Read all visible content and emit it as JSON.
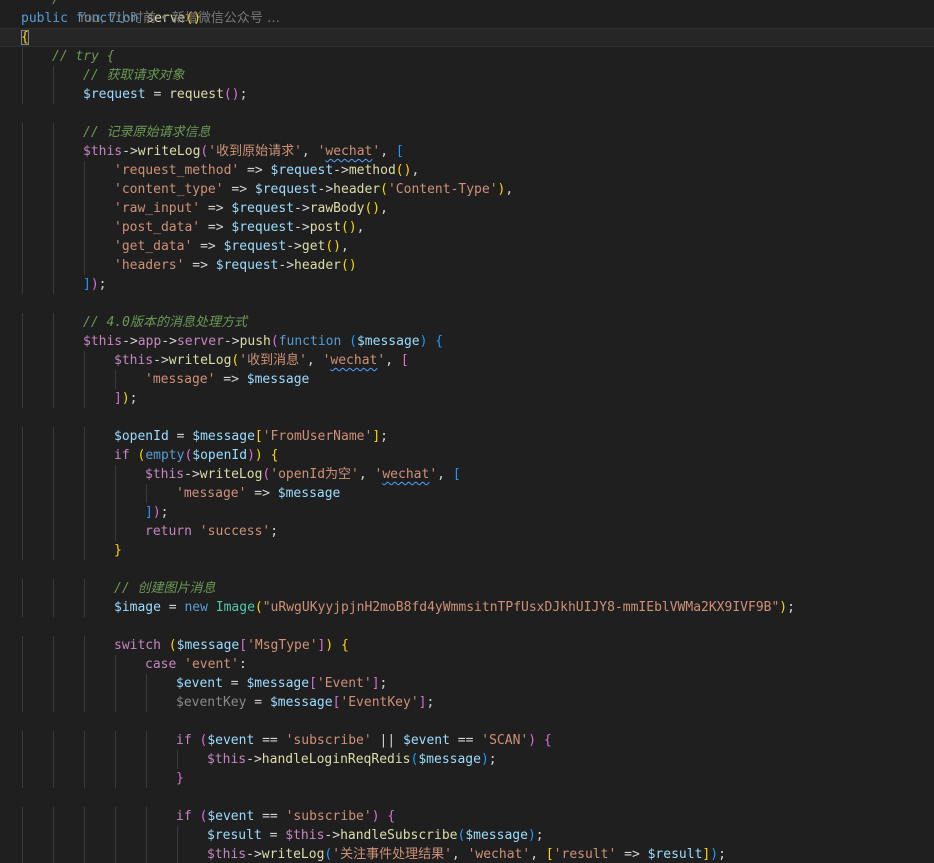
{
  "editor": {
    "blame": {
      "line": 1,
      "text": "You, 7小时前 • 新增微信公众号 …"
    },
    "lines": [
      {
        "indent": 0,
        "tokens": [
          [
            "   */",
            "cmt"
          ]
        ]
      },
      {
        "indent": 0,
        "tokens": [
          [
            "public",
            "kw"
          ],
          [
            " ",
            ""
          ],
          [
            "function",
            "kw"
          ],
          [
            " ",
            ""
          ],
          [
            "serve",
            "fn"
          ],
          [
            "()",
            "b1"
          ]
        ]
      },
      {
        "indent": 0,
        "tokens": [
          [
            "{",
            "b1 hl"
          ]
        ],
        "current": true
      },
      {
        "indent": 1,
        "tokens": [
          [
            "// try {",
            "cmt"
          ]
        ]
      },
      {
        "indent": 2,
        "tokens": [
          [
            "// 获取请求对象",
            "cmt"
          ]
        ]
      },
      {
        "indent": 2,
        "tokens": [
          [
            "$request",
            "var"
          ],
          [
            " = ",
            "punc"
          ],
          [
            "request",
            "fn"
          ],
          [
            "()",
            "b2"
          ],
          [
            ";",
            "punc"
          ]
        ]
      },
      {
        "indent": 0,
        "tokens": []
      },
      {
        "indent": 2,
        "tokens": [
          [
            "// 记录原始请求信息",
            "cmt"
          ]
        ]
      },
      {
        "indent": 2,
        "tokens": [
          [
            "$this",
            "ctrl"
          ],
          [
            "->",
            "punc"
          ],
          [
            "writeLog",
            "fn"
          ],
          [
            "(",
            "b2"
          ],
          [
            "'收到原始请求'",
            "str"
          ],
          [
            ", ",
            "punc"
          ],
          [
            "'",
            "str"
          ],
          [
            "wechat",
            "str sq"
          ],
          [
            "'",
            "str"
          ],
          [
            ", ",
            "punc"
          ],
          [
            "[",
            "b3"
          ]
        ]
      },
      {
        "indent": 3,
        "tokens": [
          [
            "'request_method'",
            "str"
          ],
          [
            " => ",
            "punc"
          ],
          [
            "$request",
            "var"
          ],
          [
            "->",
            "punc"
          ],
          [
            "method",
            "fn"
          ],
          [
            "()",
            "b1"
          ],
          [
            ",",
            "punc"
          ]
        ]
      },
      {
        "indent": 3,
        "tokens": [
          [
            "'content_type'",
            "str"
          ],
          [
            " => ",
            "punc"
          ],
          [
            "$request",
            "var"
          ],
          [
            "->",
            "punc"
          ],
          [
            "header",
            "fn"
          ],
          [
            "(",
            "b1"
          ],
          [
            "'Content-Type'",
            "str"
          ],
          [
            ")",
            "b1"
          ],
          [
            ",",
            "punc"
          ]
        ]
      },
      {
        "indent": 3,
        "tokens": [
          [
            "'raw_input'",
            "str"
          ],
          [
            " => ",
            "punc"
          ],
          [
            "$request",
            "var"
          ],
          [
            "->",
            "punc"
          ],
          [
            "rawBody",
            "fn"
          ],
          [
            "()",
            "b1"
          ],
          [
            ",",
            "punc"
          ]
        ]
      },
      {
        "indent": 3,
        "tokens": [
          [
            "'post_data'",
            "str"
          ],
          [
            " => ",
            "punc"
          ],
          [
            "$request",
            "var"
          ],
          [
            "->",
            "punc"
          ],
          [
            "post",
            "fn"
          ],
          [
            "()",
            "b1"
          ],
          [
            ",",
            "punc"
          ]
        ]
      },
      {
        "indent": 3,
        "tokens": [
          [
            "'get_data'",
            "str"
          ],
          [
            " => ",
            "punc"
          ],
          [
            "$request",
            "var"
          ],
          [
            "->",
            "punc"
          ],
          [
            "get",
            "fn"
          ],
          [
            "()",
            "b1"
          ],
          [
            ",",
            "punc"
          ]
        ]
      },
      {
        "indent": 3,
        "tokens": [
          [
            "'headers'",
            "str"
          ],
          [
            " => ",
            "punc"
          ],
          [
            "$request",
            "var"
          ],
          [
            "->",
            "punc"
          ],
          [
            "header",
            "fn"
          ],
          [
            "()",
            "b1"
          ]
        ]
      },
      {
        "indent": 2,
        "tokens": [
          [
            "]",
            "b3"
          ],
          [
            ")",
            "b2"
          ],
          [
            ";",
            "punc"
          ]
        ]
      },
      {
        "indent": 0,
        "tokens": []
      },
      {
        "indent": 2,
        "tokens": [
          [
            "// 4.0版本的消息处理方式",
            "cmt"
          ]
        ]
      },
      {
        "indent": 2,
        "tokens": [
          [
            "$this",
            "ctrl"
          ],
          [
            "->",
            "punc"
          ],
          [
            "app",
            "ctrl"
          ],
          [
            "->",
            "punc"
          ],
          [
            "server",
            "ctrl"
          ],
          [
            "->",
            "punc"
          ],
          [
            "push",
            "fn"
          ],
          [
            "(",
            "b2"
          ],
          [
            "function",
            "kw"
          ],
          [
            " ",
            ""
          ],
          [
            "(",
            "b3"
          ],
          [
            "$message",
            "var"
          ],
          [
            ")",
            "b3"
          ],
          [
            " ",
            ""
          ],
          [
            "{",
            "b3"
          ]
        ]
      },
      {
        "indent": 3,
        "tokens": [
          [
            "$this",
            "ctrl"
          ],
          [
            "->",
            "punc"
          ],
          [
            "writeLog",
            "fn"
          ],
          [
            "(",
            "b1"
          ],
          [
            "'收到消息'",
            "str"
          ],
          [
            ", ",
            "punc"
          ],
          [
            "'",
            "str"
          ],
          [
            "wechat",
            "str sq"
          ],
          [
            "'",
            "str"
          ],
          [
            ", ",
            "punc"
          ],
          [
            "[",
            "b2"
          ]
        ]
      },
      {
        "indent": 4,
        "tokens": [
          [
            "'message'",
            "str"
          ],
          [
            " => ",
            "punc"
          ],
          [
            "$message",
            "var"
          ]
        ]
      },
      {
        "indent": 3,
        "tokens": [
          [
            "]",
            "b2"
          ],
          [
            ")",
            "b1"
          ],
          [
            ";",
            "punc"
          ]
        ]
      },
      {
        "indent": 0,
        "tokens": []
      },
      {
        "indent": 3,
        "tokens": [
          [
            "$openId",
            "var"
          ],
          [
            " = ",
            "punc"
          ],
          [
            "$message",
            "var"
          ],
          [
            "[",
            "b1"
          ],
          [
            "'FromUserName'",
            "str"
          ],
          [
            "]",
            "b1"
          ],
          [
            ";",
            "punc"
          ]
        ]
      },
      {
        "indent": 3,
        "tokens": [
          [
            "if",
            "ctrl"
          ],
          [
            " ",
            ""
          ],
          [
            "(",
            "b1"
          ],
          [
            "empty",
            "kw"
          ],
          [
            "(",
            "b2"
          ],
          [
            "$openId",
            "var"
          ],
          [
            ")",
            "b2"
          ],
          [
            ")",
            "b1"
          ],
          [
            " ",
            ""
          ],
          [
            "{",
            "b1"
          ]
        ]
      },
      {
        "indent": 4,
        "tokens": [
          [
            "$this",
            "ctrl"
          ],
          [
            "->",
            "punc"
          ],
          [
            "writeLog",
            "fn"
          ],
          [
            "(",
            "b2"
          ],
          [
            "'openId为空'",
            "str"
          ],
          [
            ", ",
            "punc"
          ],
          [
            "'",
            "str"
          ],
          [
            "wechat",
            "str sq"
          ],
          [
            "'",
            "str"
          ],
          [
            ", ",
            "punc"
          ],
          [
            "[",
            "b3"
          ]
        ]
      },
      {
        "indent": 5,
        "tokens": [
          [
            "'message'",
            "str"
          ],
          [
            " => ",
            "punc"
          ],
          [
            "$message",
            "var"
          ]
        ]
      },
      {
        "indent": 4,
        "tokens": [
          [
            "]",
            "b3"
          ],
          [
            ")",
            "b2"
          ],
          [
            ";",
            "punc"
          ]
        ]
      },
      {
        "indent": 4,
        "tokens": [
          [
            "return",
            "ctrl"
          ],
          [
            " ",
            ""
          ],
          [
            "'success'",
            "str"
          ],
          [
            ";",
            "punc"
          ]
        ]
      },
      {
        "indent": 3,
        "tokens": [
          [
            "}",
            "b1"
          ]
        ]
      },
      {
        "indent": 0,
        "tokens": []
      },
      {
        "indent": 3,
        "tokens": [
          [
            "// 创建图片消息",
            "cmt"
          ]
        ]
      },
      {
        "indent": 3,
        "tokens": [
          [
            "$image",
            "var"
          ],
          [
            " = ",
            "punc"
          ],
          [
            "new",
            "kw"
          ],
          [
            " ",
            ""
          ],
          [
            "Image",
            "class"
          ],
          [
            "(",
            "b1"
          ],
          [
            "\"uRwgUKyyjpjnH2moB8fd4yWmmsitnTPfUsxDJkhUIJY8-mmIEblVWMa2KX9IVF9B\"",
            "str"
          ],
          [
            ")",
            "b1"
          ],
          [
            ";",
            "punc"
          ]
        ]
      },
      {
        "indent": 0,
        "tokens": []
      },
      {
        "indent": 3,
        "tokens": [
          [
            "switch",
            "ctrl"
          ],
          [
            " ",
            ""
          ],
          [
            "(",
            "b1"
          ],
          [
            "$message",
            "var"
          ],
          [
            "[",
            "b2"
          ],
          [
            "'MsgType'",
            "str"
          ],
          [
            "]",
            "b2"
          ],
          [
            ")",
            "b1"
          ],
          [
            " ",
            ""
          ],
          [
            "{",
            "b1"
          ]
        ]
      },
      {
        "indent": 4,
        "tokens": [
          [
            "case",
            "ctrl"
          ],
          [
            " ",
            ""
          ],
          [
            "'event'",
            "str"
          ],
          [
            ":",
            "punc"
          ]
        ]
      },
      {
        "indent": 5,
        "tokens": [
          [
            "$event",
            "var"
          ],
          [
            " = ",
            "punc"
          ],
          [
            "$message",
            "var"
          ],
          [
            "[",
            "b2"
          ],
          [
            "'Event'",
            "str"
          ],
          [
            "]",
            "b2"
          ],
          [
            ";",
            "punc"
          ]
        ]
      },
      {
        "indent": 5,
        "tokens": [
          [
            "$eventKey",
            "mute"
          ],
          [
            " = ",
            "punc"
          ],
          [
            "$message",
            "var"
          ],
          [
            "[",
            "b2"
          ],
          [
            "'EventKey'",
            "str"
          ],
          [
            "]",
            "b2"
          ],
          [
            ";",
            "punc"
          ]
        ]
      },
      {
        "indent": 0,
        "tokens": []
      },
      {
        "indent": 5,
        "tokens": [
          [
            "if",
            "ctrl"
          ],
          [
            " ",
            ""
          ],
          [
            "(",
            "b2"
          ],
          [
            "$event",
            "var"
          ],
          [
            " == ",
            "punc"
          ],
          [
            "'subscribe'",
            "str"
          ],
          [
            " || ",
            "punc"
          ],
          [
            "$event",
            "var"
          ],
          [
            " == ",
            "punc"
          ],
          [
            "'SCAN'",
            "str"
          ],
          [
            ")",
            "b2"
          ],
          [
            " ",
            ""
          ],
          [
            "{",
            "b2"
          ]
        ]
      },
      {
        "indent": 6,
        "tokens": [
          [
            "$this",
            "ctrl"
          ],
          [
            "->",
            "punc"
          ],
          [
            "handleLoginReqRedis",
            "fn"
          ],
          [
            "(",
            "b3"
          ],
          [
            "$message",
            "var"
          ],
          [
            ")",
            "b3"
          ],
          [
            ";",
            "punc"
          ]
        ]
      },
      {
        "indent": 5,
        "tokens": [
          [
            "}",
            "b2"
          ]
        ]
      },
      {
        "indent": 0,
        "tokens": []
      },
      {
        "indent": 5,
        "tokens": [
          [
            "if",
            "ctrl"
          ],
          [
            " ",
            ""
          ],
          [
            "(",
            "b2"
          ],
          [
            "$event",
            "var"
          ],
          [
            " == ",
            "punc"
          ],
          [
            "'subscribe'",
            "str"
          ],
          [
            ")",
            "b2"
          ],
          [
            " ",
            ""
          ],
          [
            "{",
            "b2"
          ]
        ]
      },
      {
        "indent": 6,
        "tokens": [
          [
            "$result",
            "var"
          ],
          [
            " = ",
            "punc"
          ],
          [
            "$this",
            "ctrl"
          ],
          [
            "->",
            "punc"
          ],
          [
            "handleSubscribe",
            "fn"
          ],
          [
            "(",
            "b3"
          ],
          [
            "$message",
            "var"
          ],
          [
            ")",
            "b3"
          ],
          [
            ";",
            "punc"
          ]
        ]
      },
      {
        "indent": 6,
        "tokens": [
          [
            "$this",
            "ctrl"
          ],
          [
            "->",
            "punc"
          ],
          [
            "writeLog",
            "fn"
          ],
          [
            "(",
            "b3"
          ],
          [
            "'关注事件处理结果'",
            "str"
          ],
          [
            ", ",
            "punc"
          ],
          [
            "'wechat'",
            "str"
          ],
          [
            ", ",
            "punc"
          ],
          [
            "[",
            "b1"
          ],
          [
            "'result'",
            "str"
          ],
          [
            " => ",
            "punc"
          ],
          [
            "$result",
            "var"
          ],
          [
            "]",
            "b1"
          ],
          [
            ")",
            "b3"
          ],
          [
            ";",
            "punc"
          ]
        ]
      }
    ]
  }
}
